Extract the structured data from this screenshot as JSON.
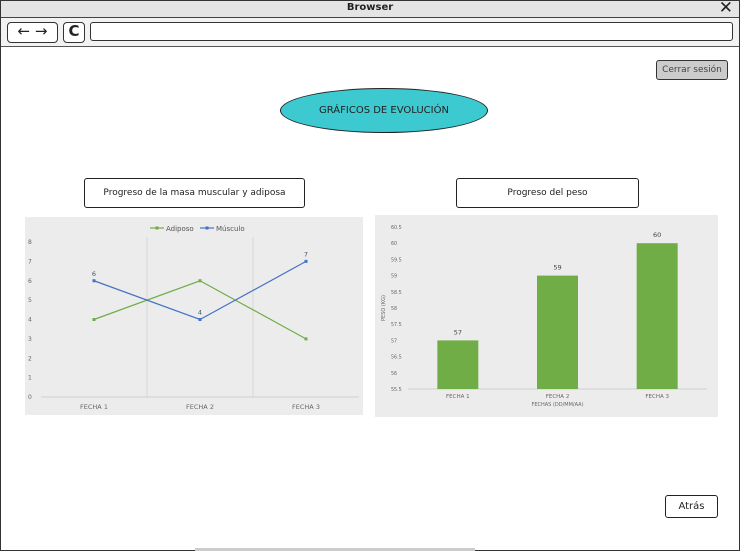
{
  "window": {
    "title": "Browser"
  },
  "toolbar": {
    "back": "←",
    "forward": "→",
    "reload": "C",
    "url": ""
  },
  "header": {
    "logout_label": "Cerrar sesión",
    "page_title": "GRÁFICOS DE EVOLUCIÓN"
  },
  "sections": {
    "muscle_title": "Progreso de la masa muscular y adiposa",
    "weight_title": "Progreso del peso"
  },
  "footer": {
    "back_label": "Atrás"
  },
  "colors": {
    "accent": "#3cc9cf",
    "adiposo": "#70ad47",
    "musculo": "#4472c4",
    "bar": "#70ad47"
  },
  "chart_data": [
    {
      "type": "line",
      "categories": [
        "FECHA 1",
        "FECHA 2",
        "FECHA 3"
      ],
      "series": [
        {
          "name": "Adiposo",
          "values": [
            4,
            6,
            3
          ]
        },
        {
          "name": "Músculo",
          "values": [
            6,
            4,
            7
          ]
        }
      ],
      "data_labels": [
        6,
        4,
        7
      ],
      "ylim": [
        0,
        8
      ],
      "yticks": [
        0,
        1,
        2,
        3,
        4,
        5,
        6,
        7,
        8
      ],
      "legend": "top"
    },
    {
      "type": "bar",
      "categories": [
        "FECHA 1",
        "FECHA 2",
        "FECHA 3"
      ],
      "values": [
        57,
        59,
        60
      ],
      "xlabel": "FECHAS (DD/MM/AA)",
      "ylabel": "PESO (KG)",
      "ylim": [
        55.5,
        60.5
      ],
      "yticks": [
        "55.5",
        "56",
        "56.5",
        "57",
        "57.5",
        "58",
        "58.5",
        "59",
        "59.5",
        "60",
        "60.5"
      ]
    }
  ]
}
